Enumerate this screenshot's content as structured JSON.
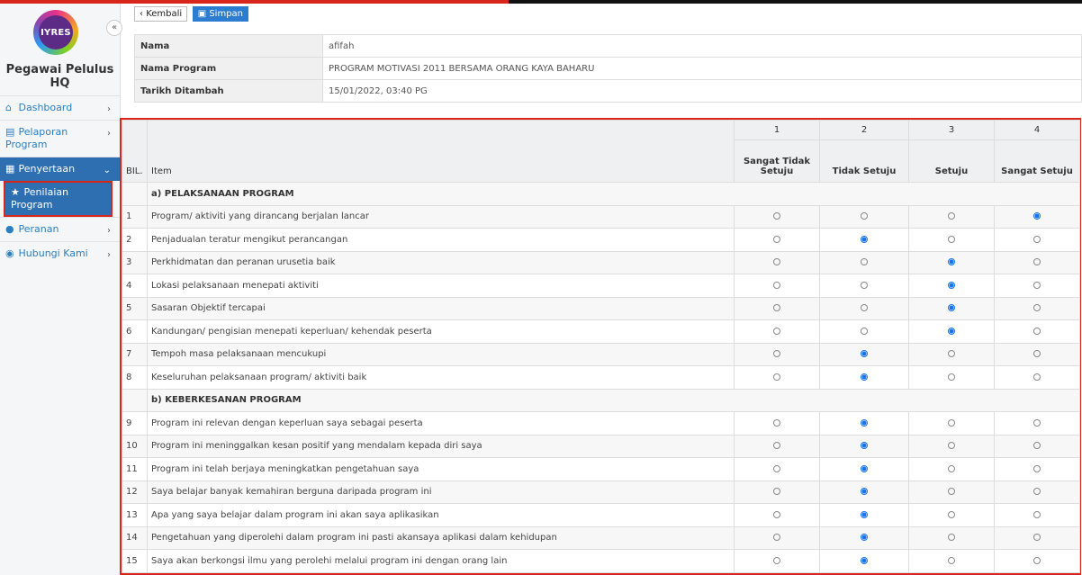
{
  "sidebar": {
    "logo_text": "IYRES",
    "title": "Pegawai Pelulus HQ",
    "collapse": "«",
    "nav": [
      {
        "label": "Dashboard",
        "icon": "home-icon",
        "chev": "›"
      },
      {
        "label": "Pelaporan Program",
        "icon": "file-icon",
        "chev": "›"
      },
      {
        "label": "Penyertaan",
        "icon": "clipboard-icon",
        "chev": "⌄"
      },
      {
        "label": "Peranan",
        "icon": "user-icon",
        "chev": "›"
      },
      {
        "label": "Hubungi Kami",
        "icon": "chat-icon",
        "chev": "›"
      }
    ],
    "sub_item": {
      "label": "Penilaian Program",
      "icon": "star-icon"
    }
  },
  "toolbar": {
    "back_label": "Kembali",
    "save_label": "Simpan"
  },
  "info": [
    {
      "key": "Nama",
      "value": "afifah"
    },
    {
      "key": "Nama Program",
      "value": "PROGRAM MOTIVASI 2011 BERSAMA ORANG KAYA BAHARU"
    },
    {
      "key": "Tarikh Ditambah",
      "value": "15/01/2022, 03:40 PG"
    }
  ],
  "table": {
    "col_bil": "BIL.",
    "col_item": "Item",
    "scale_numbers": [
      "1",
      "2",
      "3",
      "4"
    ],
    "scale_labels": [
      "Sangat Tidak Setuju",
      "Tidak Setuju",
      "Setuju",
      "Sangat Setuju"
    ],
    "section_a": "a) PELAKSANAAN PROGRAM",
    "section_b": "b) KEBERKESANAN PROGRAM",
    "rows_a": [
      {
        "no": "1",
        "item": "Program/ aktiviti yang dirancang berjalan lancar",
        "selected": 4
      },
      {
        "no": "2",
        "item": "Penjadualan teratur mengikut perancangan",
        "selected": 2
      },
      {
        "no": "3",
        "item": "Perkhidmatan dan peranan urusetia baik",
        "selected": 3
      },
      {
        "no": "4",
        "item": "Lokasi pelaksanaan menepati aktiviti",
        "selected": 3
      },
      {
        "no": "5",
        "item": "Sasaran Objektif tercapai",
        "selected": 3
      },
      {
        "no": "6",
        "item": "Kandungan/ pengisian menepati keperluan/ kehendak peserta",
        "selected": 3
      },
      {
        "no": "7",
        "item": "Tempoh masa pelaksanaan mencukupi",
        "selected": 2
      },
      {
        "no": "8",
        "item": "Keseluruhan pelaksanaan program/ aktiviti baik",
        "selected": 2
      }
    ],
    "rows_b": [
      {
        "no": "9",
        "item": "Program ini relevan dengan keperluan saya sebagai peserta",
        "selected": 2
      },
      {
        "no": "10",
        "item": "Program ini meninggalkan kesan positif yang mendalam kepada diri saya",
        "selected": 2
      },
      {
        "no": "11",
        "item": "Program ini telah berjaya meningkatkan pengetahuan saya",
        "selected": 2
      },
      {
        "no": "12",
        "item": "Saya belajar banyak kemahiran berguna daripada program ini",
        "selected": 2
      },
      {
        "no": "13",
        "item": "Apa yang saya belajar dalam program ini akan saya aplikasikan",
        "selected": 2
      },
      {
        "no": "14",
        "item": "Pengetahuan yang diperolehi dalam program ini pasti akansaya aplikasi dalam kehidupan",
        "selected": 2
      },
      {
        "no": "15",
        "item": "Saya akan berkongsi ilmu yang perolehi melalui program ini dengan orang lain",
        "selected": 2
      }
    ]
  }
}
